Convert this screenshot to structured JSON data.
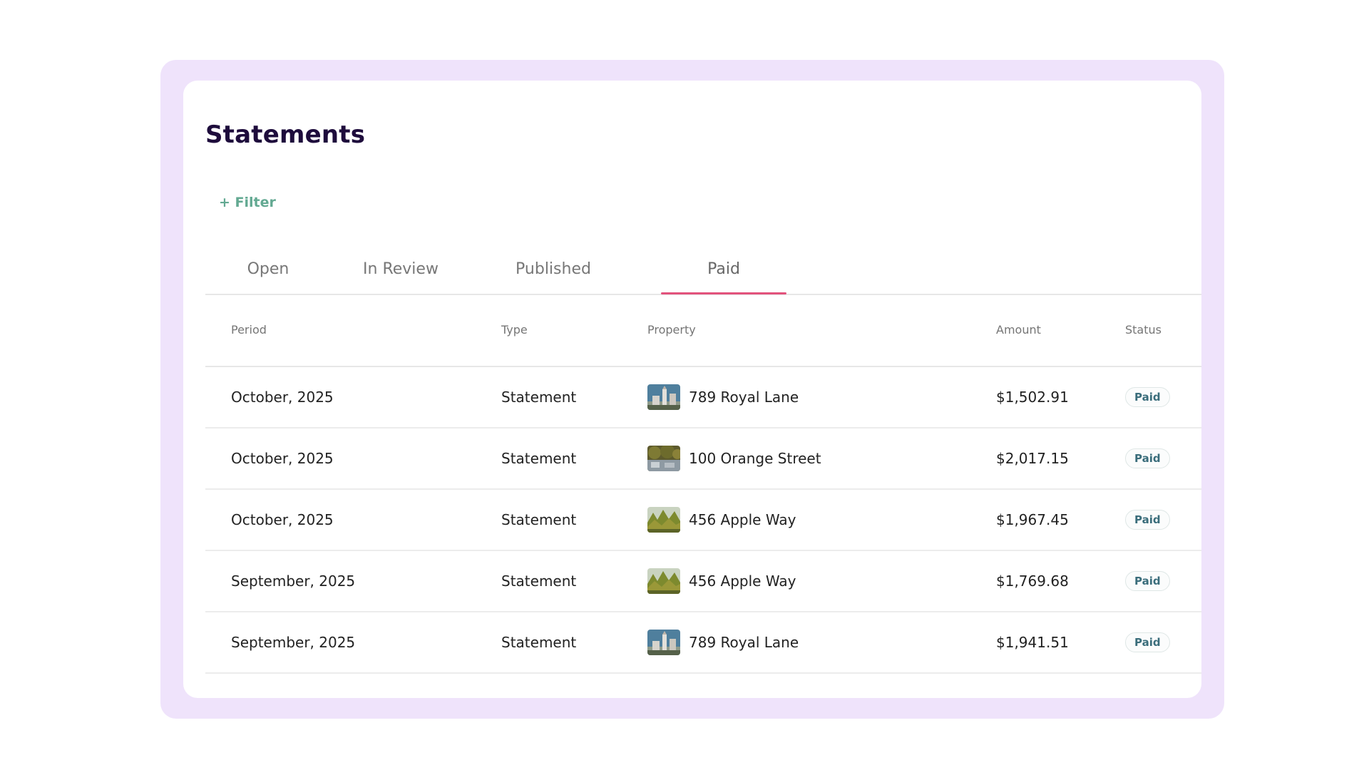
{
  "page": {
    "title": "Statements",
    "filter_label": "+ Filter"
  },
  "tabs": [
    {
      "label": "Open"
    },
    {
      "label": "In Review"
    },
    {
      "label": "Published"
    },
    {
      "label": "Paid",
      "selected": true
    }
  ],
  "table": {
    "headers": {
      "period": "Period",
      "type": "Type",
      "property": "Property",
      "amount": "Amount",
      "status": "Status"
    },
    "rows": [
      {
        "period": "October, 2025",
        "type": "Statement",
        "property": "789 Royal Lane",
        "amount": "$1,502.91",
        "status": "Paid",
        "thumb_icon": "royal-lane-thumbnail-icon"
      },
      {
        "period": "October, 2025",
        "type": "Statement",
        "property": "100 Orange Street",
        "amount": "$2,017.15",
        "status": "Paid",
        "thumb_icon": "orange-street-thumbnail-icon"
      },
      {
        "period": "October, 2025",
        "type": "Statement",
        "property": "456 Apple Way",
        "amount": "$1,967.45",
        "status": "Paid",
        "thumb_icon": "apple-way-thumbnail-icon"
      },
      {
        "period": "September, 2025",
        "type": "Statement",
        "property": "456 Apple Way",
        "amount": "$1,769.68",
        "status": "Paid",
        "thumb_icon": "apple-way-thumbnail-icon"
      },
      {
        "period": "September, 2025",
        "type": "Statement",
        "property": "789 Royal Lane",
        "amount": "$1,941.51",
        "status": "Paid",
        "thumb_icon": "royal-lane-thumbnail-icon"
      }
    ]
  },
  "colors": {
    "outer_background": "#efe3fb",
    "title": "#1e0c3c",
    "filter": "#63a992",
    "active_tab_underline": "#e2527c",
    "badge_text": "#3a6d7b"
  }
}
